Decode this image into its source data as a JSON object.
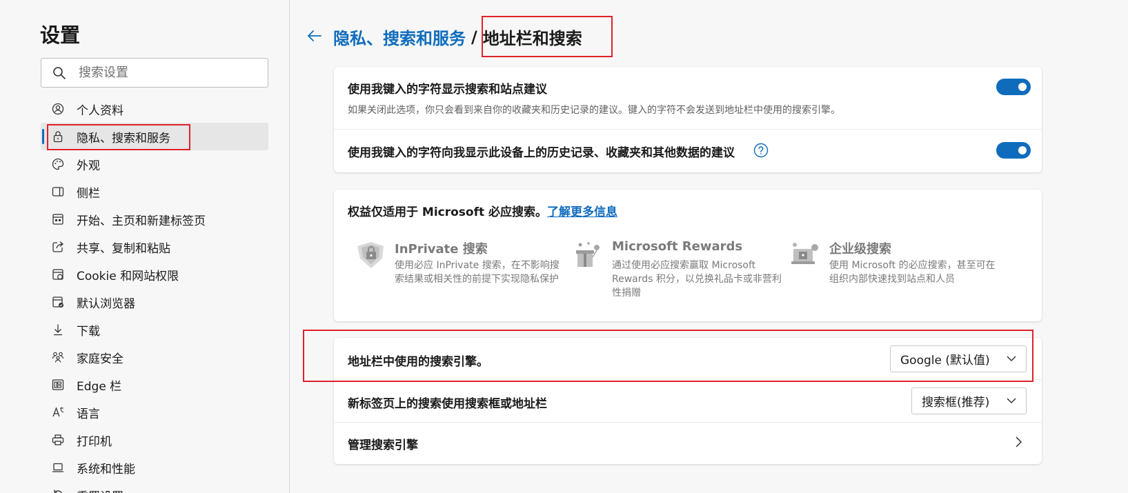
{
  "sidebar": {
    "title": "设置",
    "search_placeholder": "搜索设置",
    "items": [
      {
        "label": "个人资料",
        "icon": "profile-icon"
      },
      {
        "label": "隐私、搜索和服务",
        "icon": "lock-icon"
      },
      {
        "label": "外观",
        "icon": "palette-icon"
      },
      {
        "label": "侧栏",
        "icon": "sidebar-icon"
      },
      {
        "label": "开始、主页和新建标签页",
        "icon": "home-tab-icon"
      },
      {
        "label": "共享、复制和粘贴",
        "icon": "share-icon"
      },
      {
        "label": "Cookie 和网站权限",
        "icon": "cookie-icon"
      },
      {
        "label": "默认浏览器",
        "icon": "browser-icon"
      },
      {
        "label": "下载",
        "icon": "download-icon"
      },
      {
        "label": "家庭安全",
        "icon": "family-icon"
      },
      {
        "label": "Edge 栏",
        "icon": "edge-bar-icon"
      },
      {
        "label": "语言",
        "icon": "language-icon"
      },
      {
        "label": "打印机",
        "icon": "printer-icon"
      },
      {
        "label": "系统和性能",
        "icon": "laptop-icon"
      },
      {
        "label": "重置设置",
        "icon": "reset-icon"
      }
    ]
  },
  "header": {
    "breadcrumb_parent": "隐私、搜索和服务",
    "separator": "/",
    "title": "地址栏和搜索"
  },
  "suggestions": {
    "row1_title": "使用我键入的字符显示搜索和站点建议",
    "row1_desc": "如果关闭此选项，你只会看到来自你的收藏夹和历史记录的建议。键入的字符不会发送到地址栏中使用的搜索引擎。",
    "row1_toggle": "on",
    "row2_title": "使用我键入的字符向我显示此设备上的历史记录、收藏夹和其他数据的建议",
    "row2_toggle": "on"
  },
  "benefits": {
    "heading": "权益仅适用于 Microsoft 必应搜索。",
    "learn_more": "了解更多信息",
    "items": [
      {
        "title": "InPrivate 搜索",
        "desc": "使用必应 InPrivate 搜索，在不影响搜索结果或相关性的前提下实现隐私保护"
      },
      {
        "title": "Microsoft Rewards",
        "desc": "通过使用必应搜索赢取 Microsoft Rewards 积分，以兑换礼品卡或非营利性捐赠"
      },
      {
        "title": "企业级搜索",
        "desc": "使用 Microsoft 的必应搜索，甚至可在组织内部快速找到站点和人员"
      }
    ]
  },
  "engine": {
    "row1_title": "地址栏中使用的搜索引擎。",
    "row1_value": "Google (默认值)",
    "row2_title": "新标签页上的搜索使用搜索框或地址栏",
    "row2_value": "搜索框(推荐)",
    "row3_title": "管理搜索引擎"
  },
  "colors": {
    "accent": "#0f6cbd",
    "highlight_box": "#e0202a"
  }
}
